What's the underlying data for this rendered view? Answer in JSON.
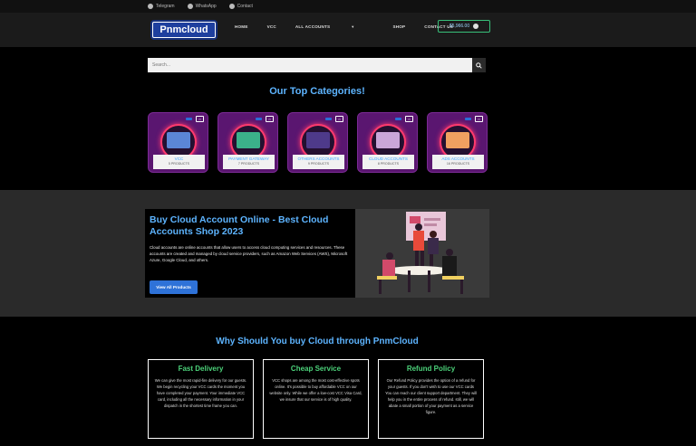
{
  "topbar": {
    "items": [
      {
        "label": "Telegram",
        "icon": "telegram-icon"
      },
      {
        "label": "WhatsApp",
        "icon": "whatsapp-icon"
      },
      {
        "label": "Contact",
        "icon": "mail-icon"
      }
    ]
  },
  "header": {
    "logo": "Pnmcloud",
    "nav": [
      "HOME",
      "VCC",
      "ALL ACCOUNTS",
      "SHOP",
      "CONTACT US"
    ],
    "cart_amount": "$5,966.00"
  },
  "search": {
    "placeholder": "Search..."
  },
  "categories": {
    "title": "Our Top Categories!",
    "items": [
      {
        "name": "VCC",
        "count": "5 PRODUCTS",
        "color": "#5b86d6"
      },
      {
        "name": "PAYMENT GATEWAY",
        "count": "7 PRODUCTS",
        "color": "#3bb18a"
      },
      {
        "name": "OTHERS ACCOUNTS",
        "count": "9 PRODUCTS",
        "color": "#4e3a8a"
      },
      {
        "name": "CLOUD ACCOUNTS",
        "count": "8 PRODUCTS",
        "color": "#caa6d8"
      },
      {
        "name": "ADS ACCOUNTS",
        "count": "16 PRODUCTS",
        "color": "#f0a060"
      }
    ]
  },
  "hero": {
    "title": "Buy Cloud Account Online - Best Cloud Accounts Shop 2023",
    "text": "Cloud accounts are online accounts that allow users to access cloud computing services and resources. These accounts are created and managed by cloud service providers, such as Amazon Web Services (AWS), Microsoft Azure, Google Cloud, and others.",
    "button": "View All Products"
  },
  "why": {
    "title": "Why Should You buy Cloud through PnmCloud",
    "boxes": [
      {
        "title": "Fast Delivery",
        "text": "We can give the most rapid-fire delivery for our guests. We begin recycling your VCC cards the moment you have completed your payment. Your immediate VCC card, including all the necessary information in your dispatch in the shortest time frame you can."
      },
      {
        "title": "Cheap Service",
        "text": "VCC shops are among the most cost-effective spots online. It's possible to buy affordable VCC on our website only. While we offer a low-cost VCC Visa Card, we insure that our service is of high quality."
      },
      {
        "title": "Refund Policy",
        "text": "Our Refund Policy provides the option of a refund for your guests. If you don't wish to use our VCC cards You can reach our client support department. They will help you in the entire process of refund. still, we will abate a small portion of your payment as a service figure."
      }
    ]
  }
}
